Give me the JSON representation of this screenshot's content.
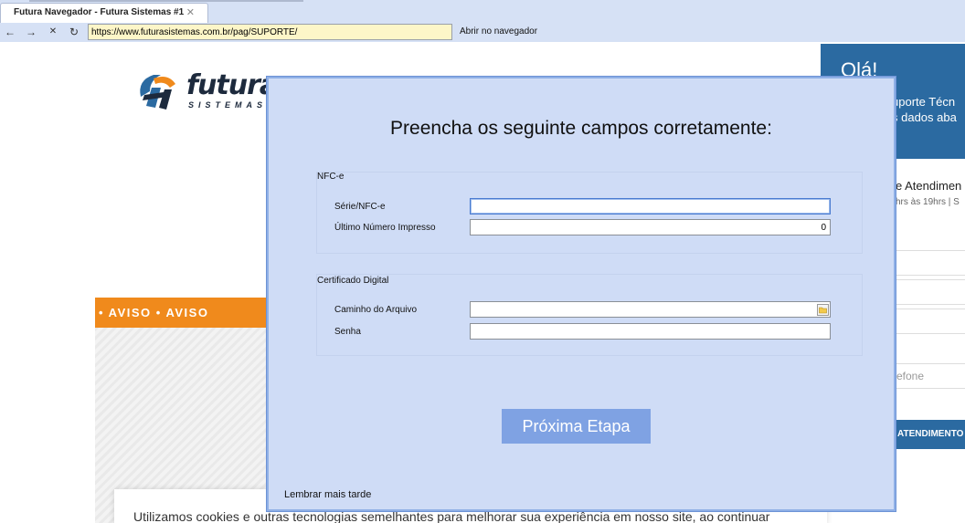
{
  "browser": {
    "tab_title": "Futura Navegador - Futura Sistemas #1",
    "tab_close": "✕",
    "nav": {
      "back": "←",
      "forward": "→",
      "stop": "✕",
      "reload": "↻"
    },
    "url": "https://www.futurasistemas.com.br/pag/SUPORTE/",
    "open_in_browser": "Abrir no navegador"
  },
  "site": {
    "logo_word": "futura",
    "logo_sub": "SISTEMAS",
    "aviso_text": "• AVISO  •  AVISO",
    "cookie_text": "Utilizamos cookies e outras tecnologias semelhantes para melhorar sua experiência em nosso site, ao continuar",
    "side": {
      "greeting": "Olá!",
      "line1": "uporte Técn",
      "line2": "s dados aba",
      "atendimento": "e Atendimen",
      "hours": "hrs às 19hrs | S",
      "phone_placeholder": "efone",
      "button": "ATENDIMENTO"
    }
  },
  "dialog": {
    "title": "Preencha os seguinte campos corretamente:",
    "nfce_group": {
      "label": "NFC-e",
      "serie_label": "Série/NFC-e",
      "serie_value": "",
      "ultimo_label": "Último Número Impresso",
      "ultimo_value": "0"
    },
    "cert_group": {
      "label": "Certificado Digital",
      "caminho_label": "Caminho do Arquivo",
      "caminho_value": "",
      "senha_label": "Senha",
      "senha_value": ""
    },
    "next_button": "Próxima Etapa",
    "remind_later": "Lembrar mais tarde"
  },
  "colors": {
    "dialog_bg": "#cfdcf6",
    "button_bg": "#7fa2e3",
    "aviso_orange": "#f08a1c",
    "side_blue": "#2b6aa1"
  }
}
